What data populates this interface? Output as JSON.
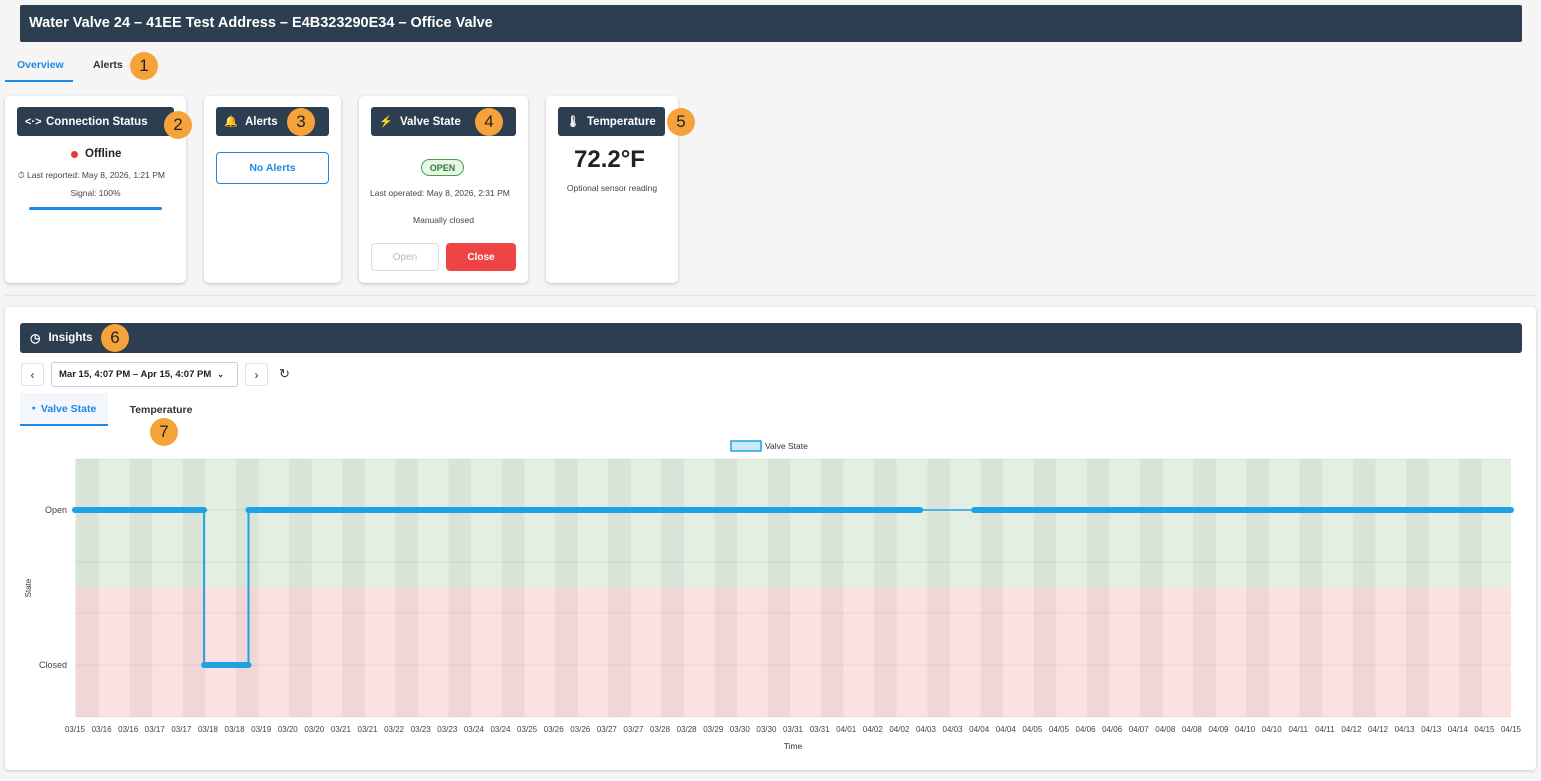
{
  "header": {
    "title": "Water Valve 24 – 41EE Test Address – E4B323290E34 – Office Valve"
  },
  "tabs": {
    "overview": "Overview",
    "alerts": "Alerts"
  },
  "badges": [
    "1",
    "2",
    "3",
    "4",
    "5",
    "6",
    "7"
  ],
  "connection": {
    "title": "Connection Status",
    "status": "Offline",
    "last_reported": "Last reported: May 8, 2026, 1:21 PM",
    "signal": "Signal: 100%",
    "signal_level": 1.0,
    "status_color": "#e53935"
  },
  "alerts_card": {
    "title": "Alerts",
    "button": "No Alerts"
  },
  "valve": {
    "title": "Valve State",
    "state": "OPEN",
    "last_operated": "Last operated: May 8, 2026, 2:31 PM",
    "note": "Manually closed",
    "open_label": "Open",
    "close_label": "Close"
  },
  "temperature": {
    "title": "Temperature",
    "value": "72.2°F",
    "note": "Optional sensor reading"
  },
  "insights": {
    "title": "Insights",
    "range": "Mar 15, 4:07 PM – Apr 15, 4:07 PM",
    "tab_valve": "Valve State",
    "tab_temperature": "Temperature"
  },
  "colors": {
    "header_bg": "#2c3e50",
    "accent": "#1e88e5",
    "danger": "#ef4444",
    "badge": "#f6a23b",
    "line": "#1ea2e4"
  },
  "chart_data": {
    "type": "line",
    "title": "",
    "legend": [
      "Valve State"
    ],
    "legend_position": "top-center",
    "xlabel": "Time",
    "ylabel": "State",
    "y_categories": [
      "Closed",
      "Open"
    ],
    "x_tick_labels": [
      "03/15",
      "03/16",
      "03/16",
      "03/17",
      "03/17",
      "03/18",
      "03/18",
      "03/19",
      "03/20",
      "03/20",
      "03/21",
      "03/21",
      "03/22",
      "03/23",
      "03/23",
      "03/24",
      "03/24",
      "03/25",
      "03/26",
      "03/26",
      "03/27",
      "03/27",
      "03/28",
      "03/28",
      "03/29",
      "03/30",
      "03/30",
      "03/31",
      "03/31",
      "04/01",
      "04/02",
      "04/02",
      "04/03",
      "04/03",
      "04/04",
      "04/04",
      "04/05",
      "04/05",
      "04/06",
      "04/06",
      "04/07",
      "04/08",
      "04/08",
      "04/09",
      "04/10",
      "04/10",
      "04/11",
      "04/11",
      "04/12",
      "04/12",
      "04/13",
      "04/13",
      "04/14",
      "04/15",
      "04/15"
    ],
    "xlim": [
      "03/15 16:07",
      "04/15 16:07"
    ],
    "series": [
      {
        "name": "Valve State",
        "points": [
          {
            "x": "03/15 16:07",
            "y": "Open"
          },
          {
            "x": "03/18 11:00",
            "y": "Open"
          },
          {
            "x": "03/18 11:00",
            "y": "Closed"
          },
          {
            "x": "03/19 10:00",
            "y": "Closed"
          },
          {
            "x": "03/19 10:00",
            "y": "Open"
          },
          {
            "x": "04/02 22:00",
            "y": "Open"
          },
          {
            "x": "04/04 02:00",
            "y": "Open"
          },
          {
            "x": "04/15 16:07",
            "y": "Open"
          }
        ],
        "gap": {
          "from": "04/02 22:00",
          "to": "04/04 02:00"
        }
      }
    ],
    "grid": true
  }
}
